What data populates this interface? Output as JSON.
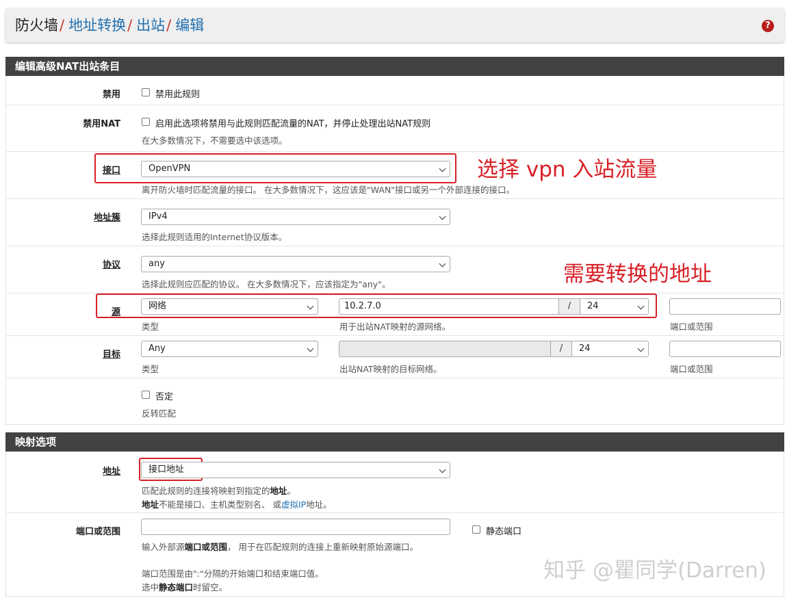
{
  "breadcrumb": {
    "items": [
      "防火墙",
      "地址转换",
      "出站",
      "编辑"
    ],
    "separator": "/"
  },
  "help_icon": {
    "glyph": "?",
    "name": "question-circle-icon"
  },
  "panel1": {
    "title": "编辑高级NAT出站条目",
    "disabled": {
      "label": "禁用",
      "checkbox_label": "禁用此规则"
    },
    "nonat": {
      "label": "禁用NAT",
      "checkbox_label": "启用此选项将禁用与此规则匹配流量的NAT，并停止处理出站NAT规则",
      "help": "在大多数情况下，不需要选中该选项。"
    },
    "interface": {
      "label": "接口",
      "value": "OpenVPN",
      "help": "离开防火墙时匹配流量的接口。 在大多数情况下，这应该是\"WAN\"接口或另一个外部连接的接口。"
    },
    "family": {
      "label": "地址簇",
      "value": "IPv4",
      "help": "选择此规则适用的Internet协议版本。"
    },
    "protocol": {
      "label": "协议",
      "value": "any",
      "help": "选择此规则应匹配的协议。 在大多数情况下，应该指定为\"any\"。"
    },
    "source": {
      "label": "源",
      "type_value": "网络",
      "type_help": "类型",
      "address_value": "10.2.7.0",
      "slash": "/",
      "mask_value": "24",
      "address_help": "用于出站NAT映射的源网络。",
      "port_value": "",
      "port_help": "端口或范围"
    },
    "destination": {
      "label": "目标",
      "type_value": "Any",
      "type_help": "类型",
      "address_value": "",
      "slash": "/",
      "mask_value": "24",
      "address_help": "出站NAT映射的目标网络。",
      "port_value": "",
      "port_help": "端口或范围"
    },
    "invert": {
      "checkbox_label": "否定",
      "help": "反转匹配"
    }
  },
  "panel2": {
    "title": "映射选项",
    "address": {
      "label": "地址",
      "value": "接口地址",
      "help1_a": "匹配此规则的连接将映射到指定的",
      "help1_b": "地址",
      "help1_c": "。",
      "help2_a": "地址",
      "help2_b": "不能是接口、主机类型别名、 或",
      "help2_c": "虚拟IP",
      "help2_d": "地址。"
    },
    "port": {
      "label": "端口或范围",
      "value": "",
      "static_label": "静态端口",
      "help1_a": "输入外部源",
      "help1_b": "端口或范围",
      "help1_c": "， 用于在匹配规则的连接上重新映射原始源端口。",
      "help2": "端口范围是由\":\"分隔的开始端口和结束端口值。",
      "help3_a": "选中",
      "help3_b": "静态端口",
      "help3_c": "时留空。"
    }
  },
  "annotations": {
    "interface_note": "选择 vpn 入站流量",
    "source_note": "需要转换的地址"
  },
  "watermark": "知乎 @瞿同学(Darren)",
  "colors": {
    "annotation": "#d81f26",
    "header": "#424242",
    "link": "#1f6fb0"
  }
}
